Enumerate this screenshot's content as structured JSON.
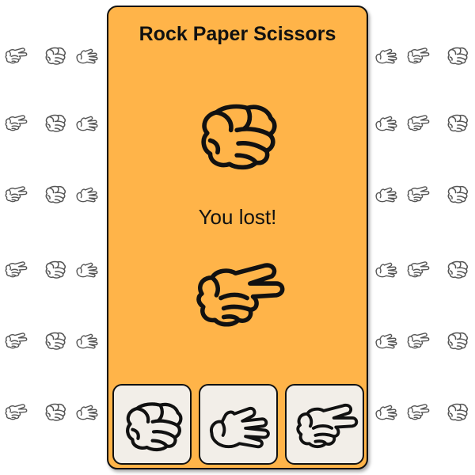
{
  "title": "Rock Paper Scissors",
  "result": "You lost!",
  "opponent_choice": "rock",
  "player_choice": "scissors",
  "buttons": [
    {
      "id": "rock",
      "icon": "rock-fist-icon"
    },
    {
      "id": "paper",
      "icon": "paper-hand-icon"
    },
    {
      "id": "scissors",
      "icon": "scissors-hand-icon"
    }
  ],
  "background_pattern": [
    "scissors-hand-icon",
    "rock-fist-icon",
    "paper-hand-icon"
  ],
  "colors": {
    "card": "#ffb449",
    "button": "#f2eee8",
    "outline": "#111111",
    "pattern_stroke": "#555555"
  }
}
